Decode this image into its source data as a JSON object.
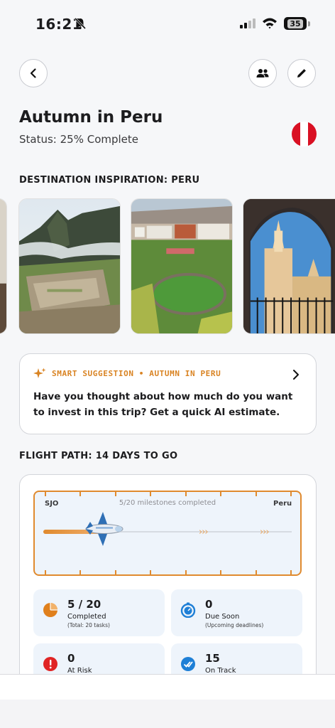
{
  "status_bar": {
    "time": "16:21",
    "battery": "35"
  },
  "header": {
    "back_icon": "chevron-left-icon",
    "people_icon": "people-icon",
    "edit_icon": "pencil-icon"
  },
  "trip": {
    "title": "Autumn in Peru",
    "status": "Status: 25% Complete",
    "flag_colors": [
      "#d91023",
      "#ffffff",
      "#d91023"
    ]
  },
  "inspiration": {
    "label": "DESTINATION INSPIRATION: PERU",
    "photos": [
      "machu-picchu-photo",
      "cusco-plaza-photo",
      "arequipa-cathedral-photo"
    ]
  },
  "suggestion": {
    "heading": "SMART SUGGESTION • AUTUMN IN PERU",
    "body": "Have you thought about how much do you want to invest in this trip? Get a quick AI estimate.",
    "accent": "#d98322"
  },
  "flight": {
    "label": "FLIGHT PATH: 14 DAYS TO GO",
    "start": "SJO",
    "end": "Peru",
    "milestones": "5/20 milestones completed",
    "progress": 0.25,
    "chevrons": "›››"
  },
  "stats": [
    {
      "value": "5 / 20",
      "label": "Completed",
      "sub": "(Total: 20 tasks)",
      "icon": "pie-chart-icon",
      "color": "#e0801c"
    },
    {
      "value": "0",
      "label": "Due Soon",
      "sub": "(Upcoming deadlines)",
      "icon": "timer-icon",
      "color": "#1e7fd6"
    },
    {
      "value": "0",
      "label": "At Risk",
      "sub": "",
      "icon": "alert-icon",
      "color": "#e02424"
    },
    {
      "value": "15",
      "label": "On Track",
      "sub": "",
      "icon": "check-badge-icon",
      "color": "#1e7fd6"
    }
  ]
}
